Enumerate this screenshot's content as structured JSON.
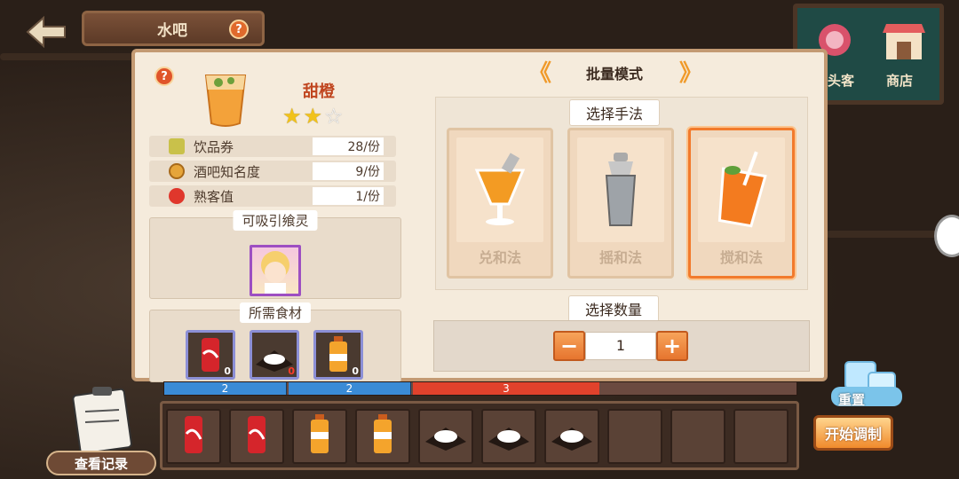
{
  "header": {
    "title": "水吧",
    "help_label": "?"
  },
  "shop_board": {
    "guest_label": "头客",
    "shop_label": "商店"
  },
  "recipe": {
    "help_label": "?",
    "name": "甜橙",
    "stars_filled": 2,
    "stars_total": 3,
    "stats": [
      {
        "label": "饮品券",
        "value": "28/份",
        "icon": "coupon-icon"
      },
      {
        "label": "酒吧知名度",
        "value": "9/份",
        "icon": "coin-icon"
      },
      {
        "label": "熟客值",
        "value": "1/份",
        "icon": "heart-icon"
      }
    ],
    "attract_title": "可吸引飨灵",
    "ingredients_title": "所需食材",
    "ingredients": [
      {
        "name": "cola-can",
        "count": "0"
      },
      {
        "name": "sugar-powder",
        "count": "0"
      },
      {
        "name": "orange-juice-bottle",
        "count": "0"
      }
    ]
  },
  "mode": {
    "label": "批量模式",
    "prev": "《",
    "next": "》"
  },
  "methods": {
    "title": "选择手法",
    "items": [
      {
        "label": "兑和法",
        "selected": false
      },
      {
        "label": "摇和法",
        "selected": false
      },
      {
        "label": "搅和法",
        "selected": true
      }
    ]
  },
  "quantity": {
    "title": "选择数量",
    "value": "1",
    "minus": "−",
    "plus": "+"
  },
  "progress": {
    "segments": [
      "2",
      "2",
      "3"
    ]
  },
  "tray": {
    "slots": [
      "cola-can",
      "cola-can",
      "orange-juice-bottle",
      "orange-juice-bottle",
      "sugar-powder",
      "sugar-powder",
      "sugar-powder",
      "",
      "",
      ""
    ]
  },
  "bottom": {
    "record_label": "查看记录",
    "reset_label": "重置",
    "start_label": "开始调制"
  }
}
